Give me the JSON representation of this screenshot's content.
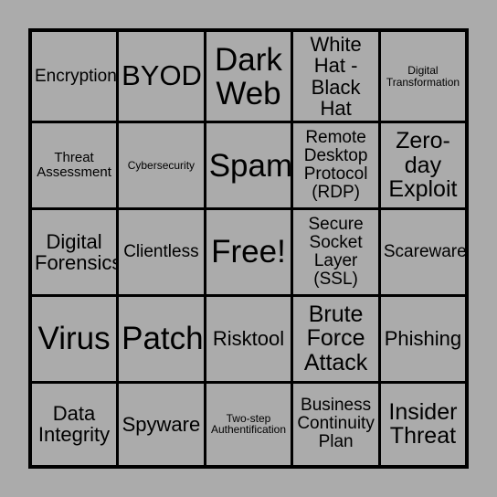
{
  "card": {
    "type": "bingo-card",
    "theme": "Cybersecurity",
    "rows": 5,
    "columns": 5,
    "background_color": "#ababab",
    "border_color": "#000000",
    "text_color": "#000000",
    "free_space": {
      "row": 3,
      "column": 3,
      "label": "Free!"
    },
    "cells": [
      [
        {
          "label": "Encryption",
          "size": "sm"
        },
        {
          "label": "BYOD",
          "size": "xl"
        },
        {
          "label": "Dark\nWeb",
          "size": "xxl"
        },
        {
          "label": "White\nHat -\nBlack Hat",
          "size": "md"
        },
        {
          "label": "Digital\nTransformation",
          "size": "xxs"
        }
      ],
      [
        {
          "label": "Threat\nAssessment",
          "size": "xs"
        },
        {
          "label": "Cybersecurity",
          "size": "xxs"
        },
        {
          "label": "Spam",
          "size": "xxl"
        },
        {
          "label": "Remote\nDesktop\nProtocol\n(RDP)",
          "size": "sm"
        },
        {
          "label": "Zero-\nday\nExploit",
          "size": "lg"
        }
      ],
      [
        {
          "label": "Digital\nForensics",
          "size": "md"
        },
        {
          "label": "Clientless",
          "size": "sm"
        },
        {
          "label": "Free!",
          "size": "xxl"
        },
        {
          "label": "Secure\nSocket\nLayer\n(SSL)",
          "size": "sm"
        },
        {
          "label": "Scareware",
          "size": "sm"
        }
      ],
      [
        {
          "label": "Virus",
          "size": "xxl"
        },
        {
          "label": "Patch",
          "size": "xxl"
        },
        {
          "label": "Risktool",
          "size": "md"
        },
        {
          "label": "Brute\nForce\nAttack",
          "size": "lg"
        },
        {
          "label": "Phishing",
          "size": "md"
        }
      ],
      [
        {
          "label": "Data\nIntegrity",
          "size": "md"
        },
        {
          "label": "Spyware",
          "size": "md"
        },
        {
          "label": "Two-step\nAuthentification",
          "size": "xxs"
        },
        {
          "label": "Business\nContinuity\nPlan",
          "size": "sm"
        },
        {
          "label": "Insider\nThreat",
          "size": "lg"
        }
      ]
    ]
  }
}
